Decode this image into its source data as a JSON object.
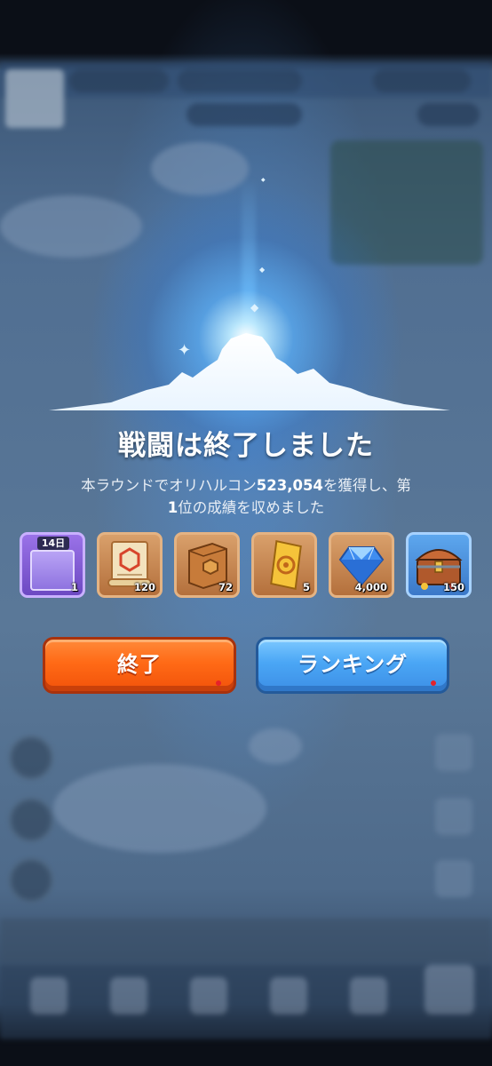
{
  "result": {
    "title": "戦闘は終了しました",
    "desc_prefix": "本ラウンドでオリハルコン",
    "orichalcum_amount": "523,054",
    "desc_middle": "を獲得し、第",
    "rank_number": "1",
    "desc_suffix": "位の成績を収めました"
  },
  "rewards": [
    {
      "name": "avatar-frame",
      "badge": "14日",
      "qty": "1",
      "icon": "purple-frame-icon"
    },
    {
      "name": "scroll",
      "qty": "120",
      "icon": "scroll-icon"
    },
    {
      "name": "book",
      "qty": "72",
      "icon": "book-icon"
    },
    {
      "name": "ticket",
      "qty": "5",
      "icon": "gold-ticket-icon"
    },
    {
      "name": "diamond",
      "qty": "4,000",
      "icon": "diamond-icon"
    },
    {
      "name": "chest",
      "qty": "150",
      "icon": "treasure-chest-icon"
    }
  ],
  "buttons": {
    "end_label": "終了",
    "ranking_label": "ランキング"
  },
  "colors": {
    "end_button": "#ff6a16",
    "ranking_button": "#4aa6f5",
    "reward_bg": "#c2834f"
  }
}
